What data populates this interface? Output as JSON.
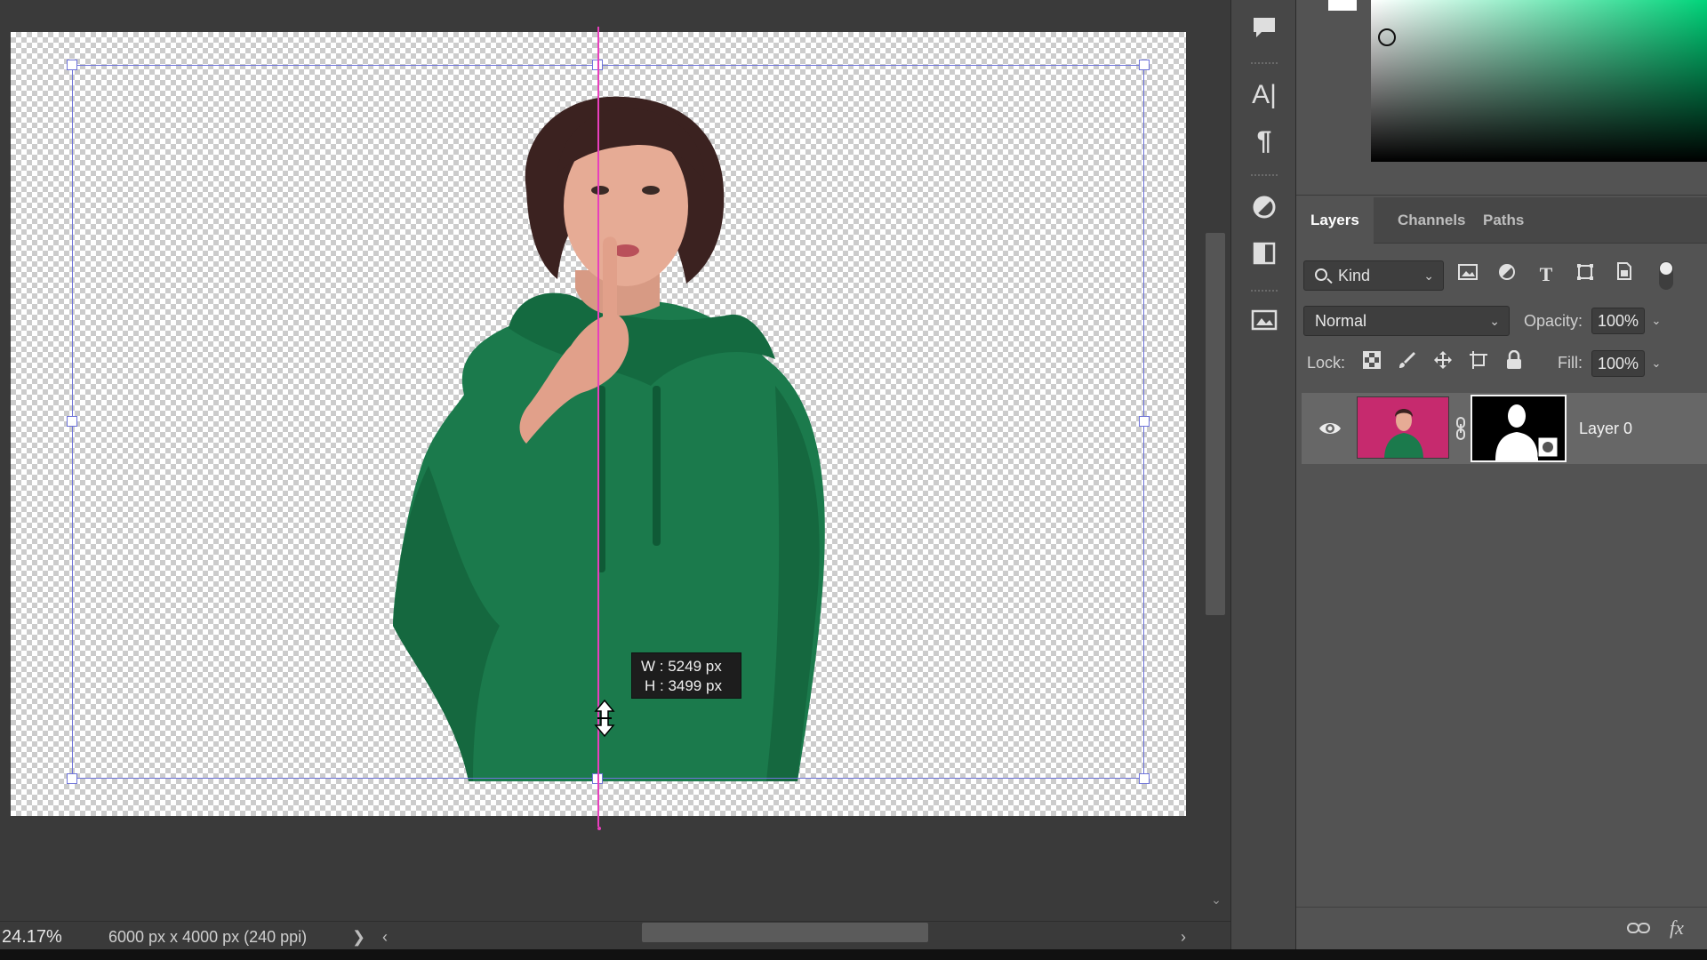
{
  "canvas": {
    "size_tooltip": {
      "width_text": "W :  5249 px",
      "height_text": "H :  3499 px"
    }
  },
  "status_bar": {
    "zoom": "24.17%",
    "doc_info": "6000 px x 4000 px (240 ppi)",
    "expand_arrow": "❯",
    "scroll_left_arrow": "‹",
    "scroll_right_arrow": "›"
  },
  "toolstrip": {
    "icons": [
      "comment-icon",
      "character-icon",
      "paragraph-icon",
      "adjustments-icon",
      "properties-icon",
      "libraries-icon"
    ]
  },
  "layers_panel": {
    "tabs": [
      {
        "label": "Layers",
        "active": true
      },
      {
        "label": "Channels",
        "active": false
      },
      {
        "label": "Paths",
        "active": false
      }
    ],
    "filter": {
      "kind_label": "Kind"
    },
    "blend_mode": "Normal",
    "opacity_label": "Opacity:",
    "opacity_value": "100%",
    "lock_label": "Lock:",
    "fill_label": "Fill:",
    "fill_value": "100%",
    "layers": [
      {
        "name": "Layer 0",
        "visible": true,
        "thumbnail_bg": "#c62a6e",
        "has_mask": true
      }
    ],
    "footer_icons": [
      "link-layers-icon",
      "fx-icon"
    ],
    "fx_label": "fx"
  },
  "colors": {
    "guide": "#e83fbd",
    "transform_box": "#6f74d9",
    "hoodie_green": "#1b7a4c",
    "thumbnail_magenta": "#c62a6e"
  }
}
